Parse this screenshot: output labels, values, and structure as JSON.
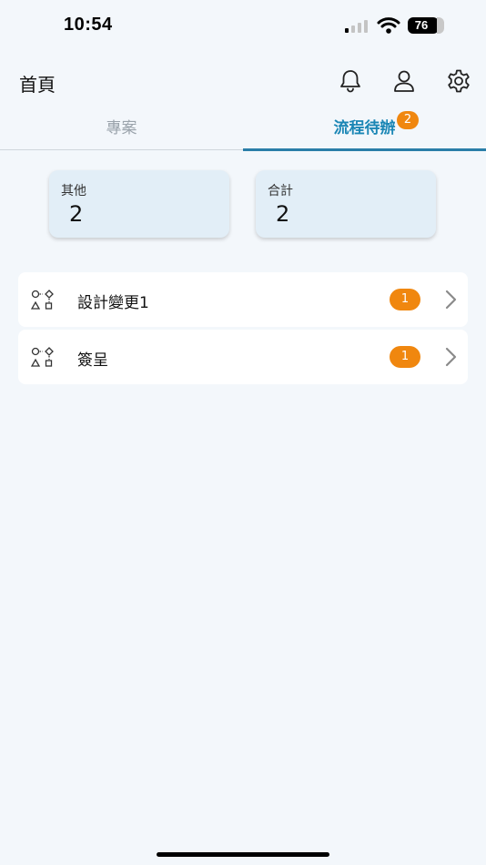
{
  "status_bar": {
    "time": "10:54",
    "battery_level": "76",
    "battery_percent": 0.76
  },
  "header": {
    "title": "首頁",
    "icons": [
      "bell-icon",
      "user-icon",
      "gear-icon"
    ]
  },
  "tabs": [
    {
      "label": "專案",
      "active": false
    },
    {
      "label": "流程待辦",
      "active": true,
      "badge": "2"
    }
  ],
  "summary": [
    {
      "label": "其他",
      "value": "2"
    },
    {
      "label": "合計",
      "value": "2"
    }
  ],
  "workflow_items": [
    {
      "label": "設計變更1",
      "count": "1",
      "icon": "workflow-icon"
    },
    {
      "label": "簽呈",
      "count": "1",
      "icon": "workflow-icon"
    }
  ],
  "colors": {
    "accent": "#1a86b5",
    "badge": "#f0870f",
    "card_bg": "#e2eef7",
    "page_bg": "#f3f7fb"
  }
}
